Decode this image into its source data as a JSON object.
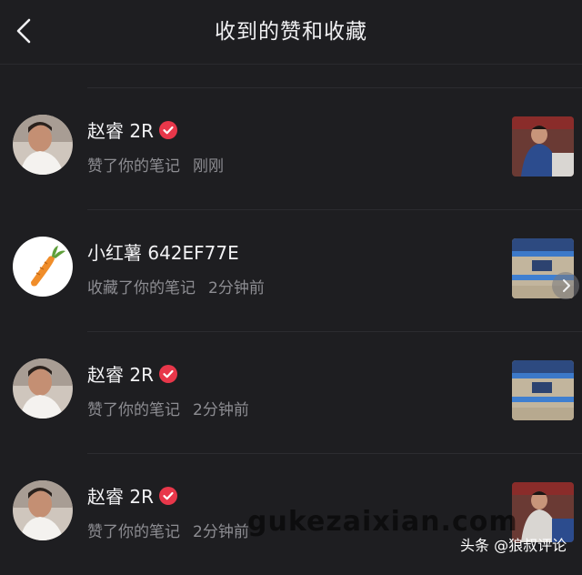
{
  "header": {
    "title": "收到的赞和收藏"
  },
  "items": [
    {
      "name": "赵睿 2R",
      "verified": true,
      "action": "赞了你的笔记",
      "time": "刚刚",
      "avatar": "person-avatar",
      "thumb": "basketball-player-closeup"
    },
    {
      "name": "小红薯 642EF77E",
      "verified": false,
      "action": "收藏了你的笔记",
      "time": "2分钟前",
      "avatar": "carrot-avatar",
      "thumb": "basketball-court"
    },
    {
      "name": "赵睿 2R",
      "verified": true,
      "action": "赞了你的笔记",
      "time": "2分钟前",
      "avatar": "person-avatar",
      "thumb": "basketball-court"
    },
    {
      "name": "赵睿 2R",
      "verified": true,
      "action": "赞了你的笔记",
      "time": "2分钟前",
      "avatar": "person-avatar",
      "thumb": "basketball-player-closeup"
    }
  ],
  "watermark": "gukezaixian.com",
  "credit": "头条 @狼叔评论",
  "colors": {
    "background": "#1e1e21",
    "verified": "#e8374a",
    "secondary_text": "#8d8d92"
  }
}
